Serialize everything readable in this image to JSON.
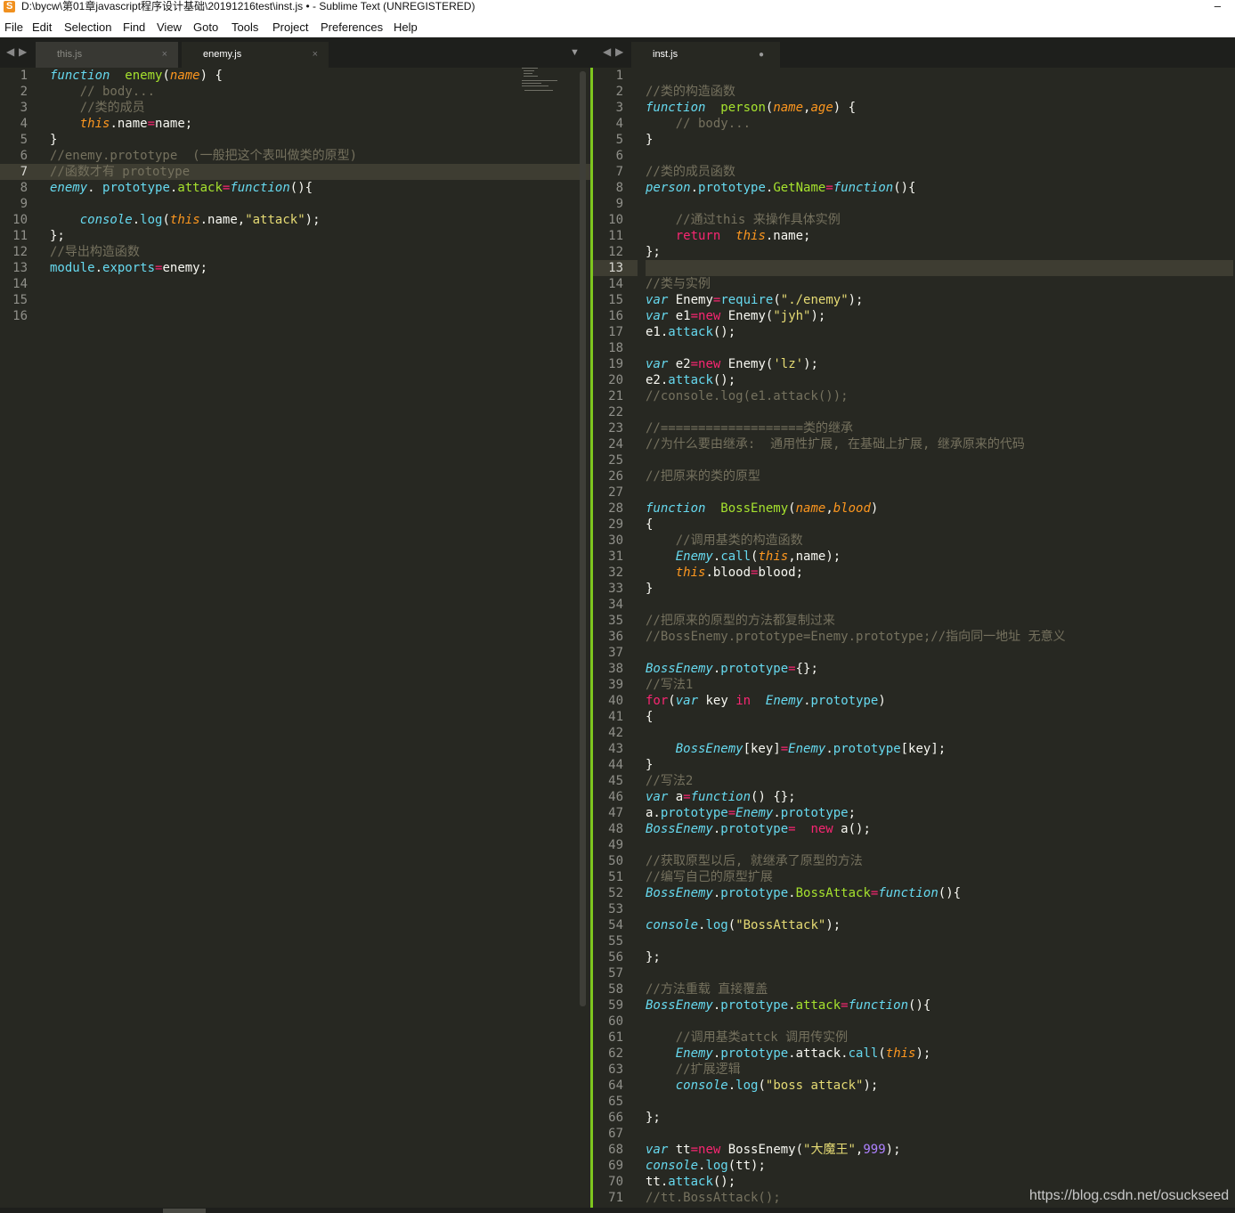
{
  "window": {
    "title": "D:\\bycw\\第01章javascript程序设计基础\\20191216test\\inst.js • - Sublime Text (UNREGISTERED)",
    "minimize": "–"
  },
  "menu": [
    "File",
    "Edit",
    "Selection",
    "Find",
    "View",
    "Goto",
    "Tools",
    "Project",
    "Preferences",
    "Help"
  ],
  "icons": {
    "app": "sublime-text-logo",
    "nav_left": "◀",
    "nav_right": "▶",
    "dropdown": "▼",
    "close": "×",
    "dirty": "●"
  },
  "left_tabs": [
    {
      "label": "this.js",
      "active": false
    },
    {
      "label": "enemy.js",
      "active": true
    }
  ],
  "right_tabs": [
    {
      "label": "inst.js",
      "active": true,
      "dirty": true
    }
  ],
  "left_current_line": 7,
  "right_current_line": 13,
  "colors": {
    "background": "#272822",
    "keyword": "#66d9ef",
    "operator": "#f92672",
    "function_name": "#a6e22e",
    "parameter": "#fd971f",
    "comment": "#75715e",
    "string": "#e6db74",
    "number": "#ae81ff",
    "pane_divider": "#7ec61e"
  },
  "left_code": [
    [
      [
        "k",
        "function"
      ],
      [
        "",
        "  "
      ],
      [
        "f",
        "enemy"
      ],
      [
        "",
        "("
      ],
      [
        "pa",
        "name"
      ],
      [
        "",
        ") {"
      ]
    ],
    [
      [
        "c",
        "    // body..."
      ]
    ],
    [
      [
        "c",
        "    //类的成员"
      ]
    ],
    [
      [
        "",
        "    "
      ],
      [
        "t",
        "this"
      ],
      [
        "",
        ".name"
      ],
      [
        "o",
        "="
      ],
      [
        "",
        "name;"
      ]
    ],
    [
      [
        "",
        "}"
      ]
    ],
    [
      [
        "c",
        "//enemy.prototype  (一般把这个表叫做类的原型)"
      ]
    ],
    [
      [
        "c",
        "//函数才有 prototype"
      ]
    ],
    [
      [
        "classname",
        "enemy"
      ],
      [
        "",
        ". "
      ],
      [
        "ps",
        "prototype"
      ],
      [
        "",
        "."
      ],
      [
        "f",
        "attack"
      ],
      [
        "o",
        "="
      ],
      [
        "k",
        "function"
      ],
      [
        "",
        "(){"
      ]
    ],
    [],
    [
      [
        "",
        "    "
      ],
      [
        "classname",
        "console"
      ],
      [
        "",
        "."
      ],
      [
        "ps",
        "log"
      ],
      [
        "",
        "("
      ],
      [
        "t",
        "this"
      ],
      [
        "",
        ".name,"
      ],
      [
        "s",
        "\"attack\""
      ],
      [
        "",
        ");"
      ]
    ],
    [
      [
        "",
        "};"
      ]
    ],
    [
      [
        "c",
        "//导出构造函数"
      ]
    ],
    [
      [
        "ps",
        "module"
      ],
      [
        "",
        "."
      ],
      [
        "ps",
        "exports"
      ],
      [
        "o",
        "="
      ],
      [
        "",
        "enemy;"
      ]
    ],
    [],
    [],
    []
  ],
  "right_code": [
    [],
    [
      [
        "c",
        "//类的构造函数"
      ]
    ],
    [
      [
        "k",
        "function"
      ],
      [
        "",
        "  "
      ],
      [
        "f",
        "person"
      ],
      [
        "",
        "("
      ],
      [
        "pa",
        "name"
      ],
      [
        "",
        ","
      ],
      [
        "pa",
        "age"
      ],
      [
        "",
        ") {"
      ]
    ],
    [
      [
        "c",
        "    // body..."
      ]
    ],
    [
      [
        "",
        "}"
      ]
    ],
    [],
    [
      [
        "c",
        "//类的成员函数"
      ]
    ],
    [
      [
        "classname",
        "person"
      ],
      [
        "",
        "."
      ],
      [
        "ps",
        "prototype"
      ],
      [
        "",
        "."
      ],
      [
        "f",
        "GetName"
      ],
      [
        "o",
        "="
      ],
      [
        "k",
        "function"
      ],
      [
        "",
        "(){"
      ]
    ],
    [],
    [
      [
        "c",
        "    //通过this 来操作具体实例"
      ]
    ],
    [
      [
        "",
        "    "
      ],
      [
        "r",
        "return"
      ],
      [
        "",
        "  "
      ],
      [
        "t",
        "this"
      ],
      [
        "",
        ".name;"
      ]
    ],
    [
      [
        "",
        "};"
      ]
    ],
    [],
    [
      [
        "c",
        "//类与实例"
      ]
    ],
    [
      [
        "k",
        "var"
      ],
      [
        "",
        " Enemy"
      ],
      [
        "o",
        "="
      ],
      [
        "ps",
        "require"
      ],
      [
        "",
        "("
      ],
      [
        "s",
        "\"./enemy\""
      ],
      [
        "",
        ");"
      ]
    ],
    [
      [
        "k",
        "var"
      ],
      [
        "",
        " e1"
      ],
      [
        "o",
        "="
      ],
      [
        "r",
        "new"
      ],
      [
        "",
        " Enemy("
      ],
      [
        "s",
        "\"jyh\""
      ],
      [
        "",
        ");"
      ]
    ],
    [
      [
        "",
        "e1."
      ],
      [
        "ps",
        "attack"
      ],
      [
        "",
        "();"
      ]
    ],
    [],
    [
      [
        "k",
        "var"
      ],
      [
        "",
        " e2"
      ],
      [
        "o",
        "="
      ],
      [
        "r",
        "new"
      ],
      [
        "",
        " Enemy("
      ],
      [
        "s",
        "'lz'"
      ],
      [
        "",
        ");"
      ]
    ],
    [
      [
        "",
        "e2."
      ],
      [
        "ps",
        "attack"
      ],
      [
        "",
        "();"
      ]
    ],
    [
      [
        "c",
        "//console.log(e1.attack());"
      ]
    ],
    [],
    [
      [
        "c",
        "//===================类的继承"
      ]
    ],
    [
      [
        "c",
        "//为什么要由继承:  通用性扩展, 在基础上扩展, 继承原来的代码"
      ]
    ],
    [],
    [
      [
        "c",
        "//把原来的类的原型"
      ]
    ],
    [],
    [
      [
        "k",
        "function"
      ],
      [
        "",
        "  "
      ],
      [
        "f",
        "BossEnemy"
      ],
      [
        "",
        "("
      ],
      [
        "pa",
        "name"
      ],
      [
        "",
        ","
      ],
      [
        "pa",
        "blood"
      ],
      [
        "",
        ")"
      ]
    ],
    [
      [
        "",
        "{"
      ]
    ],
    [
      [
        "c",
        "    //调用基类的构造函数"
      ]
    ],
    [
      [
        "",
        "    "
      ],
      [
        "classname",
        "Enemy"
      ],
      [
        "",
        "."
      ],
      [
        "ps",
        "call"
      ],
      [
        "",
        "("
      ],
      [
        "t",
        "this"
      ],
      [
        "",
        ",name);"
      ]
    ],
    [
      [
        "",
        "    "
      ],
      [
        "t",
        "this"
      ],
      [
        "",
        ".blood"
      ],
      [
        "o",
        "="
      ],
      [
        "",
        "blood;"
      ]
    ],
    [
      [
        "",
        "}"
      ]
    ],
    [],
    [
      [
        "c",
        "//把原来的原型的方法都复制过来"
      ]
    ],
    [
      [
        "c",
        "//BossEnemy.prototype=Enemy.prototype;//指向同一地址 无意义"
      ]
    ],
    [],
    [
      [
        "classname",
        "BossEnemy"
      ],
      [
        "",
        "."
      ],
      [
        "ps",
        "prototype"
      ],
      [
        "o",
        "="
      ],
      [
        "",
        "{};"
      ]
    ],
    [
      [
        "c",
        "//写法1"
      ]
    ],
    [
      [
        "r",
        "for"
      ],
      [
        "",
        "("
      ],
      [
        "k",
        "var"
      ],
      [
        "",
        " key "
      ],
      [
        "r",
        "in"
      ],
      [
        "",
        "  "
      ],
      [
        "classname",
        "Enemy"
      ],
      [
        "",
        "."
      ],
      [
        "ps",
        "prototype"
      ],
      [
        "",
        ")"
      ]
    ],
    [
      [
        "",
        "{"
      ]
    ],
    [],
    [
      [
        "",
        "    "
      ],
      [
        "classname",
        "BossEnemy"
      ],
      [
        "",
        "[key]"
      ],
      [
        "o",
        "="
      ],
      [
        "classname",
        "Enemy"
      ],
      [
        "",
        "."
      ],
      [
        "ps",
        "prototype"
      ],
      [
        "",
        "[key];"
      ]
    ],
    [
      [
        "",
        "}"
      ]
    ],
    [
      [
        "c",
        "//写法2"
      ]
    ],
    [
      [
        "k",
        "var"
      ],
      [
        "",
        " a"
      ],
      [
        "o",
        "="
      ],
      [
        "k",
        "function"
      ],
      [
        "",
        "() {};"
      ]
    ],
    [
      [
        "",
        "a."
      ],
      [
        "ps",
        "prototype"
      ],
      [
        "o",
        "="
      ],
      [
        "classname",
        "Enemy"
      ],
      [
        "",
        "."
      ],
      [
        "ps",
        "prototype"
      ],
      [
        "",
        ";"
      ]
    ],
    [
      [
        "classname",
        "BossEnemy"
      ],
      [
        "",
        "."
      ],
      [
        "ps",
        "prototype"
      ],
      [
        "o",
        "="
      ],
      [
        "",
        "  "
      ],
      [
        "r",
        "new"
      ],
      [
        "",
        " a();"
      ]
    ],
    [],
    [
      [
        "c",
        "//获取原型以后, 就继承了原型的方法"
      ]
    ],
    [
      [
        "c",
        "//编写自己的原型扩展"
      ]
    ],
    [
      [
        "classname",
        "BossEnemy"
      ],
      [
        "",
        "."
      ],
      [
        "ps",
        "prototype"
      ],
      [
        "",
        "."
      ],
      [
        "f",
        "BossAttack"
      ],
      [
        "o",
        "="
      ],
      [
        "k",
        "function"
      ],
      [
        "",
        "(){"
      ]
    ],
    [],
    [
      [
        "classname",
        "console"
      ],
      [
        "",
        "."
      ],
      [
        "ps",
        "log"
      ],
      [
        "",
        "("
      ],
      [
        "s",
        "\"BossAttack\""
      ],
      [
        "",
        ");"
      ]
    ],
    [],
    [
      [
        "",
        "};"
      ]
    ],
    [],
    [
      [
        "c",
        "//方法重载 直接覆盖"
      ]
    ],
    [
      [
        "classname",
        "BossEnemy"
      ],
      [
        "",
        "."
      ],
      [
        "ps",
        "prototype"
      ],
      [
        "",
        "."
      ],
      [
        "f",
        "attack"
      ],
      [
        "o",
        "="
      ],
      [
        "k",
        "function"
      ],
      [
        "",
        "(){"
      ]
    ],
    [],
    [
      [
        "c",
        "    //调用基类attck 调用传实例"
      ]
    ],
    [
      [
        "",
        "    "
      ],
      [
        "classname",
        "Enemy"
      ],
      [
        "",
        "."
      ],
      [
        "ps",
        "prototype"
      ],
      [
        "",
        ".attack."
      ],
      [
        "ps",
        "call"
      ],
      [
        "",
        "("
      ],
      [
        "t",
        "this"
      ],
      [
        "",
        ");"
      ]
    ],
    [
      [
        "c",
        "    //扩展逻辑"
      ]
    ],
    [
      [
        "",
        "    "
      ],
      [
        "classname",
        "console"
      ],
      [
        "",
        "."
      ],
      [
        "ps",
        "log"
      ],
      [
        "",
        "("
      ],
      [
        "s",
        "\"boss attack\""
      ],
      [
        "",
        ");"
      ]
    ],
    [],
    [
      [
        "",
        "};"
      ]
    ],
    [],
    [
      [
        "k",
        "var"
      ],
      [
        "",
        " tt"
      ],
      [
        "o",
        "="
      ],
      [
        "r",
        "new"
      ],
      [
        "",
        " BossEnemy("
      ],
      [
        "s",
        "\"大魔王\""
      ],
      [
        "",
        ","
      ],
      [
        "n",
        "999"
      ],
      [
        "",
        ");"
      ]
    ],
    [
      [
        "classname",
        "console"
      ],
      [
        "",
        "."
      ],
      [
        "ps",
        "log"
      ],
      [
        "",
        "(tt);"
      ]
    ],
    [
      [
        "",
        "tt."
      ],
      [
        "ps",
        "attack"
      ],
      [
        "",
        "();"
      ]
    ],
    [
      [
        "c",
        "//tt.BossAttack();"
      ]
    ]
  ],
  "watermark": "https://blog.csdn.net/osuckseed"
}
